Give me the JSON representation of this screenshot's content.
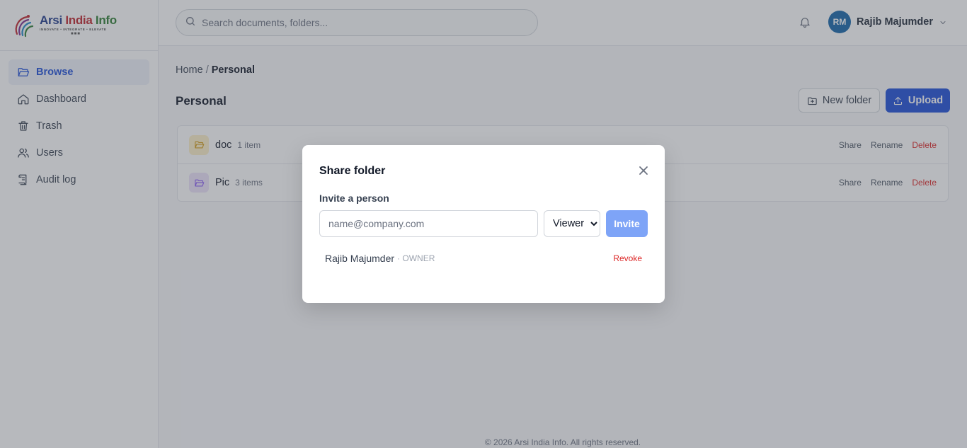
{
  "brand": {
    "name_part1": "Arsi",
    "name_part2": "India",
    "name_part3": "Info",
    "tagline": "INNOVATE • INTEGRATE • ELEVATE",
    "dots": "■■■"
  },
  "sidebar": {
    "items": [
      {
        "label": "Browse",
        "icon": "folder-open-icon",
        "active": true
      },
      {
        "label": "Dashboard",
        "icon": "home-icon",
        "active": false
      },
      {
        "label": "Trash",
        "icon": "trash-icon",
        "active": false
      },
      {
        "label": "Users",
        "icon": "users-icon",
        "active": false
      },
      {
        "label": "Audit log",
        "icon": "audit-log-icon",
        "active": false
      }
    ]
  },
  "header": {
    "search_placeholder": "Search documents, folders...",
    "user_initials": "RM",
    "user_name": "Rajib Majumder"
  },
  "main": {
    "breadcrumb_home": "Home",
    "breadcrumb_sep": "/",
    "breadcrumb_current": "Personal",
    "title": "Personal",
    "new_folder_label": "New folder",
    "upload_label": "Upload",
    "folders": [
      {
        "name": "doc",
        "count": "1 item",
        "share": "Share",
        "rename": "Rename",
        "delete": "Delete"
      },
      {
        "name": "Pic",
        "count": "3 items",
        "share": "Share",
        "rename": "Rename",
        "delete": "Delete"
      }
    ]
  },
  "footer": {
    "text": "© 2026 Arsi India Info. All rights reserved."
  },
  "modal": {
    "title": "Share folder",
    "invite_label": "Invite a person",
    "email_placeholder": "name@company.com",
    "role_selected": "Viewer",
    "invite_button": "Invite",
    "members": [
      {
        "name": "Rajib Majumder",
        "role": "· OWNER",
        "action": "Revoke"
      }
    ]
  },
  "colors": {
    "primary": "#1d4ed8",
    "avatar": "#1565a8",
    "danger": "#dc2626",
    "invite_disabled": "#7ea4f7",
    "folder_doc_bg": "#fdf0c8",
    "folder_pic_bg": "#ede3fb"
  }
}
